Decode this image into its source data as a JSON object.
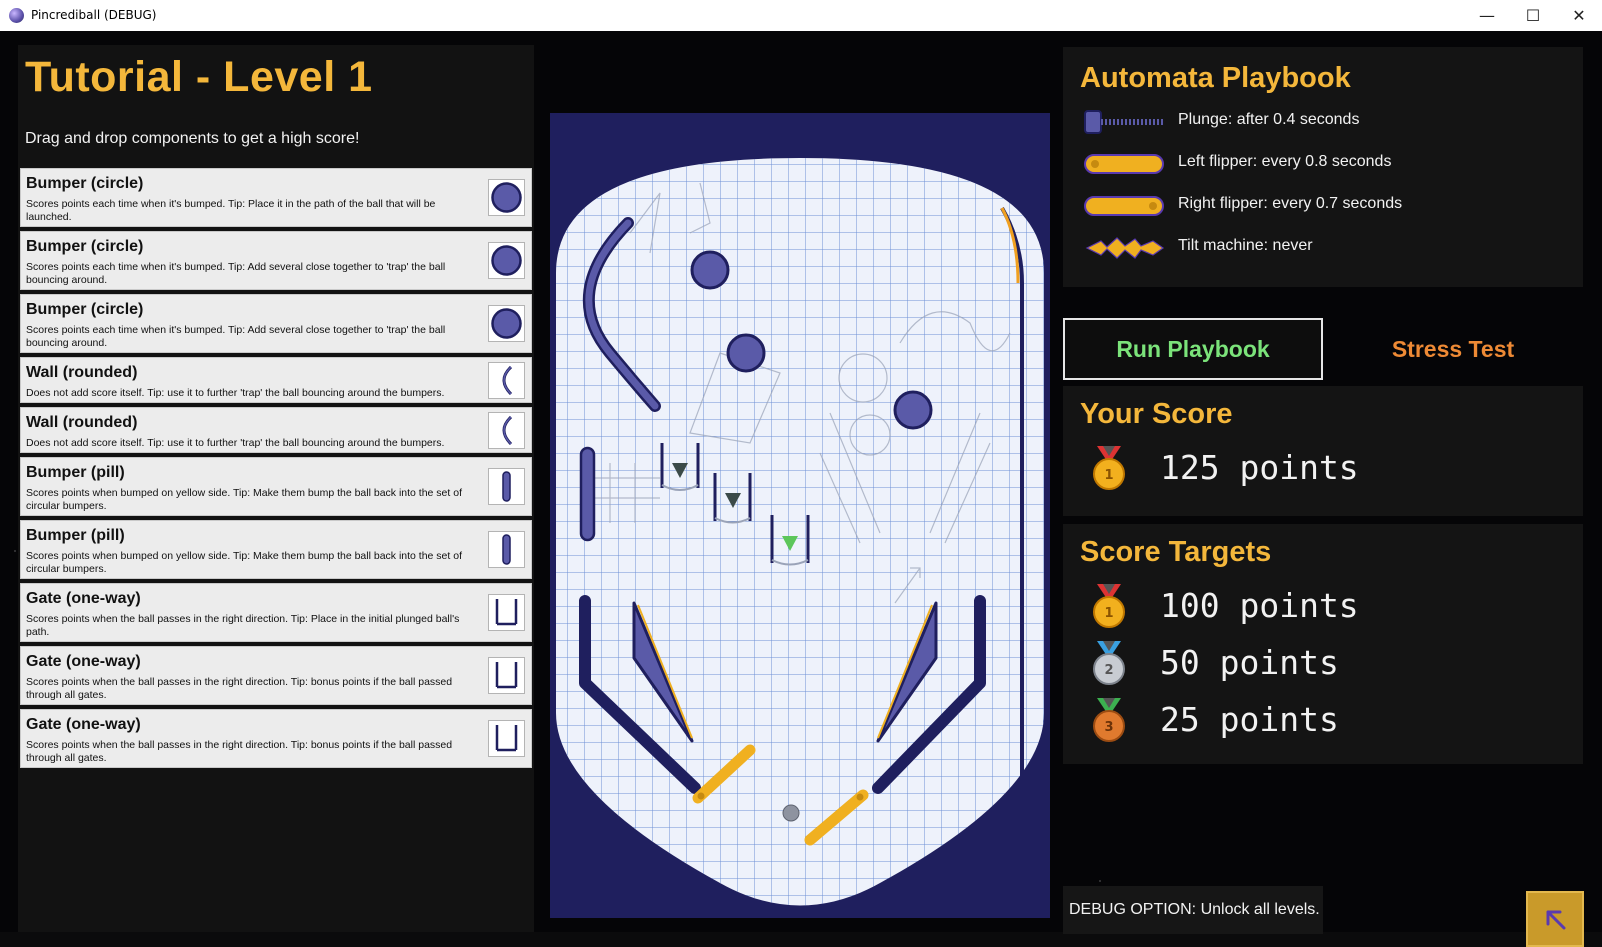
{
  "window": {
    "title": "Pincrediball (DEBUG)",
    "minimize": "—",
    "maximize": "☐",
    "close": "✕"
  },
  "level": {
    "title": "Tutorial - Level 1",
    "subtitle": "Drag and drop components to get a high score!"
  },
  "components": [
    {
      "name": "Bumper (circle)",
      "desc": "Scores points each time when it's bumped. Tip: Place it in the path of the ball that will be launched.",
      "icon": "circle-bumper-icon"
    },
    {
      "name": "Bumper (circle)",
      "desc": "Scores points each time when it's bumped. Tip: Add several close together to 'trap' the ball bouncing around.",
      "icon": "circle-bumper-icon"
    },
    {
      "name": "Bumper (circle)",
      "desc": "Scores points each time when it's bumped. Tip: Add several close together to 'trap' the ball bouncing around.",
      "icon": "circle-bumper-icon"
    },
    {
      "name": "Wall (rounded)",
      "desc": "Does not add score itself. Tip: use it to further 'trap' the ball bouncing around the bumpers.",
      "icon": "rounded-wall-icon"
    },
    {
      "name": "Wall (rounded)",
      "desc": "Does not add score itself. Tip: use it to further 'trap' the ball bouncing around the bumpers.",
      "icon": "rounded-wall-icon"
    },
    {
      "name": "Bumper (pill)",
      "desc": "Scores points when bumped on yellow side. Tip: Make them bump the ball back into the set of circular bumpers.",
      "icon": "pill-bumper-icon"
    },
    {
      "name": "Bumper (pill)",
      "desc": "Scores points when bumped on yellow side. Tip: Make them bump the ball back into the set of circular bumpers.",
      "icon": "pill-bumper-icon"
    },
    {
      "name": "Gate (one-way)",
      "desc": "Scores points when the ball passes in the right direction. Tip: Place in the initial plunged ball's path.",
      "icon": "gate-icon"
    },
    {
      "name": "Gate (one-way)",
      "desc": "Scores points when the ball passes in the right direction. Tip: bonus points if the ball passed through all gates.",
      "icon": "gate-icon"
    },
    {
      "name": "Gate (one-way)",
      "desc": "Scores points when the ball passes in the right direction. Tip: bonus points if the ball passed through all gates.",
      "icon": "gate-icon"
    }
  ],
  "playbook": {
    "title": "Automata Playbook",
    "rows": [
      {
        "icon": "plunger-icon",
        "label": "Plunge: after 0.4 seconds"
      },
      {
        "icon": "left-flipper-icon",
        "label": "Left flipper: every 0.8 seconds"
      },
      {
        "icon": "right-flipper-icon",
        "label": "Right flipper: every 0.7 seconds"
      },
      {
        "icon": "tilt-icon",
        "label": "Tilt machine: never"
      }
    ],
    "run_label": "Run Playbook",
    "stress_label": "Stress Test"
  },
  "score": {
    "title": "Your Score",
    "value": "125 points",
    "medal": "gold-medal-icon"
  },
  "targets": {
    "title": "Score Targets",
    "items": [
      {
        "label": "100 points",
        "medal": "gold-medal-icon",
        "rank": "1"
      },
      {
        "label": "50 points",
        "medal": "silver-medal-icon",
        "rank": "2"
      },
      {
        "label": "25 points",
        "medal": "bronze-medal-icon",
        "rank": "3"
      }
    ]
  },
  "debug": {
    "label": "DEBUG OPTION: Unlock all levels."
  },
  "colors": {
    "accent": "#f4b73b",
    "run": "#7be37a",
    "stress": "#ee8a35",
    "board": "#1f1f5e",
    "part": "#5a5aa8"
  }
}
